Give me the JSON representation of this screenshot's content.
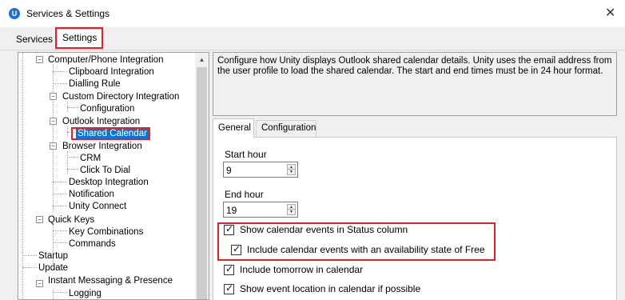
{
  "window": {
    "title": "Services & Settings",
    "app_icon_letter": "U",
    "close_glyph": "✕"
  },
  "main_tabs": {
    "services": "Services",
    "settings": "Settings"
  },
  "tree": {
    "expander_open": "−",
    "scroll_up_glyph": "▲",
    "items": [
      {
        "label": "Computer/Phone Integration"
      },
      {
        "label": "Clipboard Integration"
      },
      {
        "label": "Dialling Rule"
      },
      {
        "label": "Custom Directory Integration"
      },
      {
        "label": "Configuration"
      },
      {
        "label": "Outlook Integration"
      },
      {
        "label": "Shared Calendar"
      },
      {
        "label": "Browser Integration"
      },
      {
        "label": "CRM"
      },
      {
        "label": "Click To Dial"
      },
      {
        "label": "Desktop Integration"
      },
      {
        "label": "Notification"
      },
      {
        "label": "Unity Connect"
      },
      {
        "label": "Quick Keys"
      },
      {
        "label": "Key Combinations"
      },
      {
        "label": "Commands"
      },
      {
        "label": "Startup"
      },
      {
        "label": "Update"
      },
      {
        "label": "Instant Messaging & Presence"
      },
      {
        "label": "Logging"
      }
    ]
  },
  "description": "Configure how Unity displays Outlook shared calendar details.  Unity uses the email address from the user profile to load the shared calendar.  The start and end times must be in 24 hour format.",
  "inner_tabs": {
    "general": "General",
    "configuration": "Configuration"
  },
  "general": {
    "start_hour_label": "Start hour",
    "start_hour_value": "9",
    "end_hour_label": "End hour",
    "end_hour_value": "19",
    "spin_up_glyph": "▲",
    "spin_down_glyph": "▼",
    "check_glyph": "✓",
    "checkboxes": [
      {
        "label": "Show calendar events in Status column",
        "checked": true
      },
      {
        "label": "Include calendar events with an availability state of Free",
        "checked": true
      },
      {
        "label": "Include tomorrow in calendar",
        "checked": true
      },
      {
        "label": "Show event location in calendar if possible",
        "checked": true
      }
    ]
  },
  "colors": {
    "highlight_border": "#dd2228",
    "selection": "#0078d7",
    "app_icon": "#1e73c9"
  }
}
